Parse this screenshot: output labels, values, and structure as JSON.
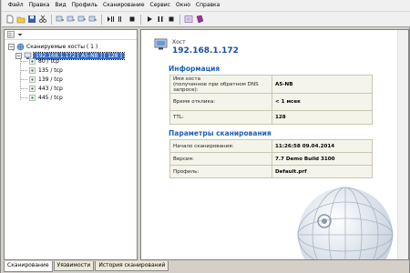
{
  "menu": [
    {
      "label": "Файл",
      "name": "menu-file"
    },
    {
      "label": "Правка",
      "name": "menu-edit"
    },
    {
      "label": "Вид",
      "name": "menu-view"
    },
    {
      "label": "Профиль",
      "name": "menu-profile"
    },
    {
      "label": "Сканирование",
      "name": "menu-scan"
    },
    {
      "label": "Сервис",
      "name": "menu-service"
    },
    {
      "label": "Окно",
      "name": "menu-window"
    },
    {
      "label": "Справка",
      "name": "menu-help"
    }
  ],
  "toolbar_icons": [
    "new-icon",
    "open-icon",
    "save-icon",
    "cut-icon",
    "host-add-icon",
    "host-remove-icon",
    "host-up-icon",
    "host-down-icon",
    "pause-icon",
    "stop-icon",
    "start-icon",
    "step-icon",
    "pause2-icon",
    "stop2-icon",
    "options-icon",
    "report-icon"
  ],
  "tree": {
    "root_label": "Сканируемые хосты ( 1 )",
    "host_label": "192.168.1.172 [ A5-NB ] [ 128 ]",
    "ports": [
      "80 / tcp",
      "135 / tcp",
      "139 / tcp",
      "443 / tcp",
      "445 / tcp"
    ]
  },
  "detail": {
    "host_caption": "Хост",
    "host_ip": "192.168.1.172",
    "info_title": "Информация",
    "info_rows": [
      {
        "key_line1": "Имя хоста",
        "key_line2": "(полученное при обратном DNS запросе):",
        "value": "A5-NB"
      },
      {
        "key_line1": "Время отклика:",
        "key_line2": "",
        "value": "< 1 мсек"
      },
      {
        "key_line1": "TTL:",
        "key_line2": "",
        "value": "128"
      }
    ],
    "params_title": "Параметры сканирования",
    "params_rows": [
      {
        "key": "Начало сканирования:",
        "value": "11:26:58 09.04.2014"
      },
      {
        "key": "Версия:",
        "value": "7.7 Demo Build 3100"
      },
      {
        "key": "Профиль:",
        "value": "Default.prf"
      }
    ]
  },
  "tabs": [
    {
      "label": "Сканирование",
      "active": true
    },
    {
      "label": "Уязвимости",
      "active": false
    },
    {
      "label": "История сканирований",
      "active": false
    }
  ],
  "colors": {
    "selection": "#3169c6",
    "title_blue": "#1a62b8",
    "ip_blue": "#1a4fa0",
    "table_bg": "#f5f4ea"
  }
}
